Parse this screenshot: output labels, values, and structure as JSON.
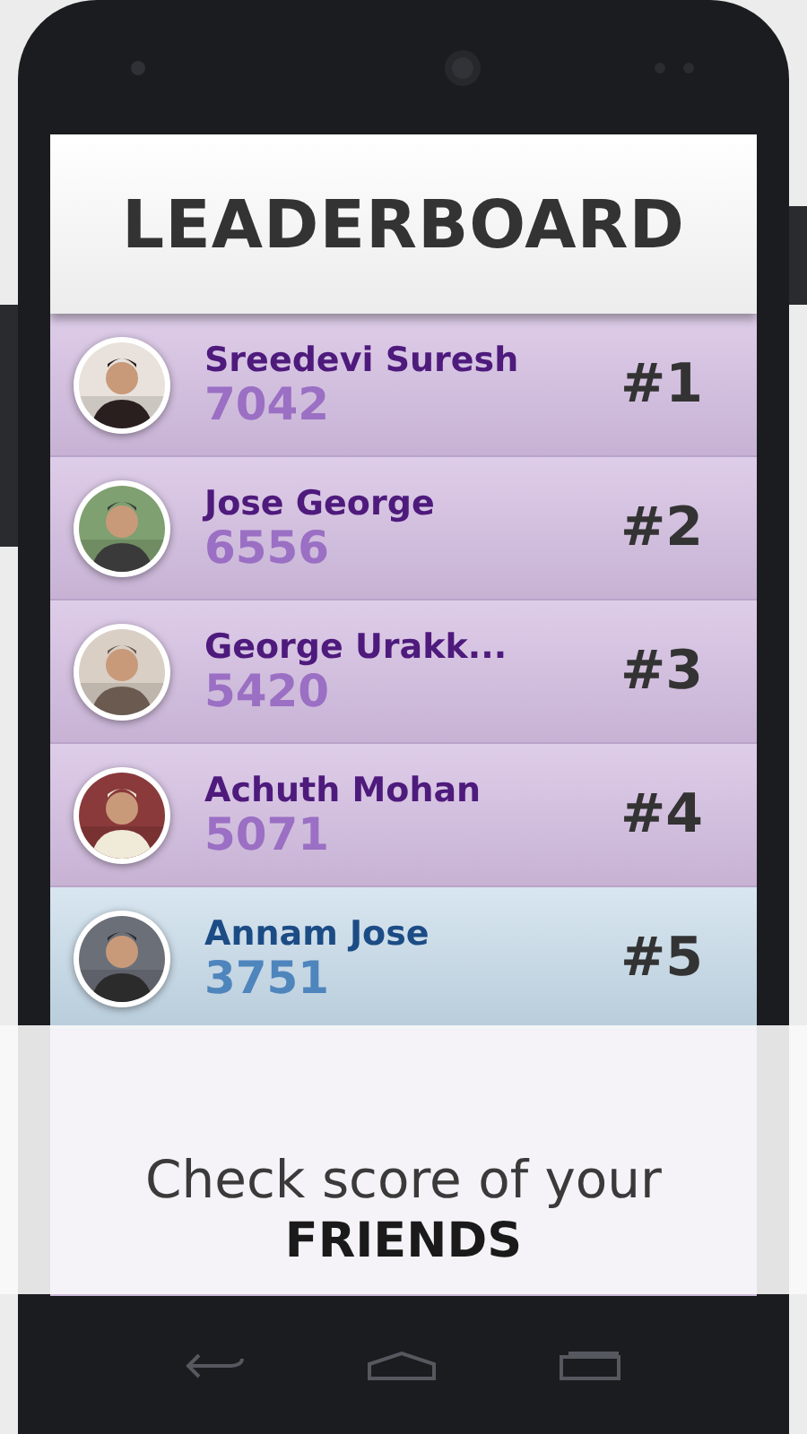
{
  "header": {
    "title": "LEADERBOARD"
  },
  "rows": [
    {
      "name": "Sreedevi Suresh",
      "score": "7042",
      "rank": "#1",
      "highlighted": false
    },
    {
      "name": "Jose George",
      "score": "6556",
      "rank": "#2",
      "highlighted": false
    },
    {
      "name": "George Urakk...",
      "score": "5420",
      "rank": "#3",
      "highlighted": false
    },
    {
      "name": "Achuth Mohan",
      "score": "5071",
      "rank": "#4",
      "highlighted": false
    },
    {
      "name": "Annam Jose",
      "score": "3751",
      "rank": "#5",
      "highlighted": true
    }
  ],
  "overlay": {
    "line_1": "Check score of your",
    "line_2": "FRIENDS"
  }
}
